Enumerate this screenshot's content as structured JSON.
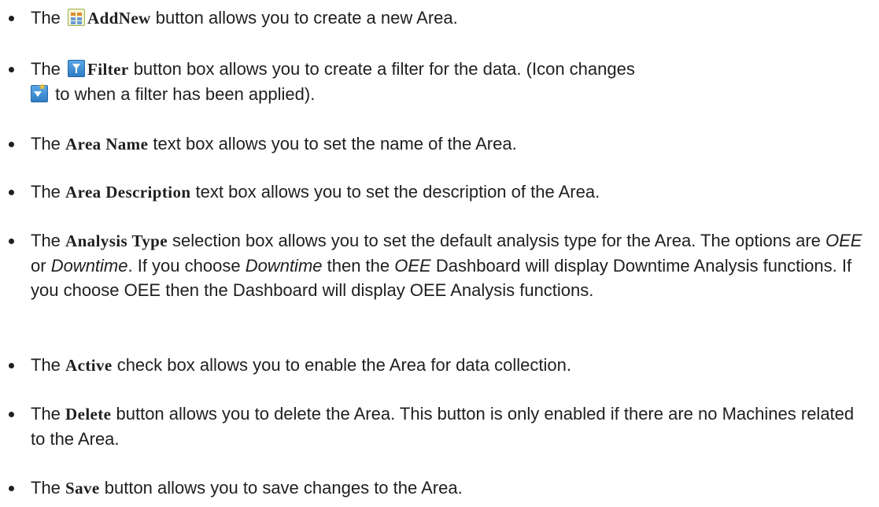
{
  "items": [
    {
      "before": "The ",
      "term": "AddNew",
      "icon": "addnew-icon",
      "after": " button allows you to create a new Area."
    },
    {
      "before": "The ",
      "term": "Filter",
      "icon": "filter-icon",
      "after1": " button box allows you to create a filter for the data. (Icon changes",
      "icon2": "filter-applied-icon",
      "after2": " to when a filter has been applied)."
    },
    {
      "before": "The ",
      "term": "Area Name",
      "after": " text box allows you to set the name of the Area."
    },
    {
      "before": "The ",
      "term": "Area Description",
      "after": " text box allows you to set the description of the Area."
    },
    {
      "before": "The ",
      "term": "Analysis Type",
      "t1": " selection box allows you to set the default analysis type for the Area. The options are ",
      "e1": "OEE",
      "t2": " or ",
      "e2": "Downtime",
      "t3": ". If you choose ",
      "e3": "Downtime",
      "t4": " then the ",
      "e4": "OEE",
      "t5": " Dashboard will display Downtime Analysis functions. If you choose OEE then the Dashboard will display OEE Analysis functions."
    },
    {
      "before": "The ",
      "term": "Active",
      "after": " check box allows you to enable the Area for data collection."
    },
    {
      "before": "The ",
      "term": "Delete",
      "after": " button allows you to delete the Area. This button is only enabled if there are no Machines related to the Area."
    },
    {
      "before": "The ",
      "term": "Save",
      "after": " button allows you to save changes to the Area."
    }
  ]
}
